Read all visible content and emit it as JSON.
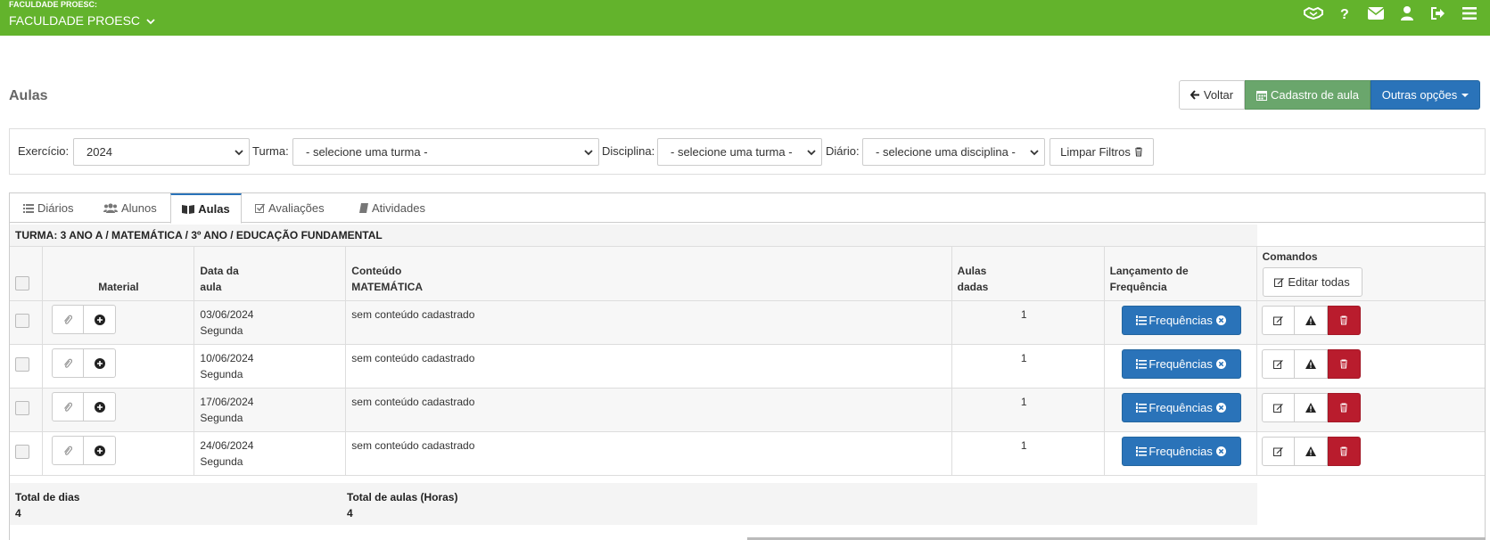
{
  "header": {
    "org_small": "FACULDADE PROESC:",
    "org_main": "FACULDADE PROESC",
    "icons": [
      "handshake-icon",
      "question-icon",
      "envelope-icon",
      "user-icon",
      "sign-out-icon",
      "menu-icon"
    ],
    "bg_color": "#63b32c"
  },
  "page": {
    "title": "Aulas",
    "buttons": {
      "voltar": "Voltar",
      "cadastro": "Cadastro de aula",
      "outras": "Outras opções"
    }
  },
  "filters": {
    "exercicio_label": "Exercício:",
    "exercicio_value": "2024",
    "turma_label": "Turma:",
    "turma_value": "- selecione uma turma -",
    "disciplina_label": "Disciplina:",
    "disciplina_value": "- selecione uma turma -",
    "diario_label": "Diário:",
    "diario_value": "- selecione uma disciplina -",
    "limpar": "Limpar Filtros"
  },
  "tabs": [
    "Diários",
    "Alunos",
    "Aulas",
    "Avaliações",
    "Atividades"
  ],
  "active_tab": "Aulas",
  "turma_info": "TURMA: 3 ANO A / MATEMÁTICA / 3º ANO / EDUCAÇÃO FUNDAMENTAL",
  "table": {
    "headers": {
      "material": "Material",
      "data_1": "Data da",
      "data_2": "aula",
      "conteudo_1": "Conteúdo",
      "conteudo_2": "MATEMÁTICA",
      "aulas_1": "Aulas",
      "aulas_2": "dadas",
      "lanc_1": "Lançamento de",
      "lanc_2": "Frequência",
      "comandos": "Comandos",
      "editar_todas": "Editar todas"
    },
    "rows": [
      {
        "date": "03/06/2024",
        "day": "Segunda",
        "content": "sem conteúdo cadastrado",
        "aulas": "1",
        "freq": "Frequências"
      },
      {
        "date": "10/06/2024",
        "day": "Segunda",
        "content": "sem conteúdo cadastrado",
        "aulas": "1",
        "freq": "Frequências"
      },
      {
        "date": "17/06/2024",
        "day": "Segunda",
        "content": "sem conteúdo cadastrado",
        "aulas": "1",
        "freq": "Frequências"
      },
      {
        "date": "24/06/2024",
        "day": "Segunda",
        "content": "sem conteúdo cadastrado",
        "aulas": "1",
        "freq": "Frequências"
      }
    ]
  },
  "totals": {
    "dias_label": "Total de dias",
    "dias_value": "4",
    "aulas_label": "Total de aulas (Horas)",
    "aulas_value": "4"
  }
}
